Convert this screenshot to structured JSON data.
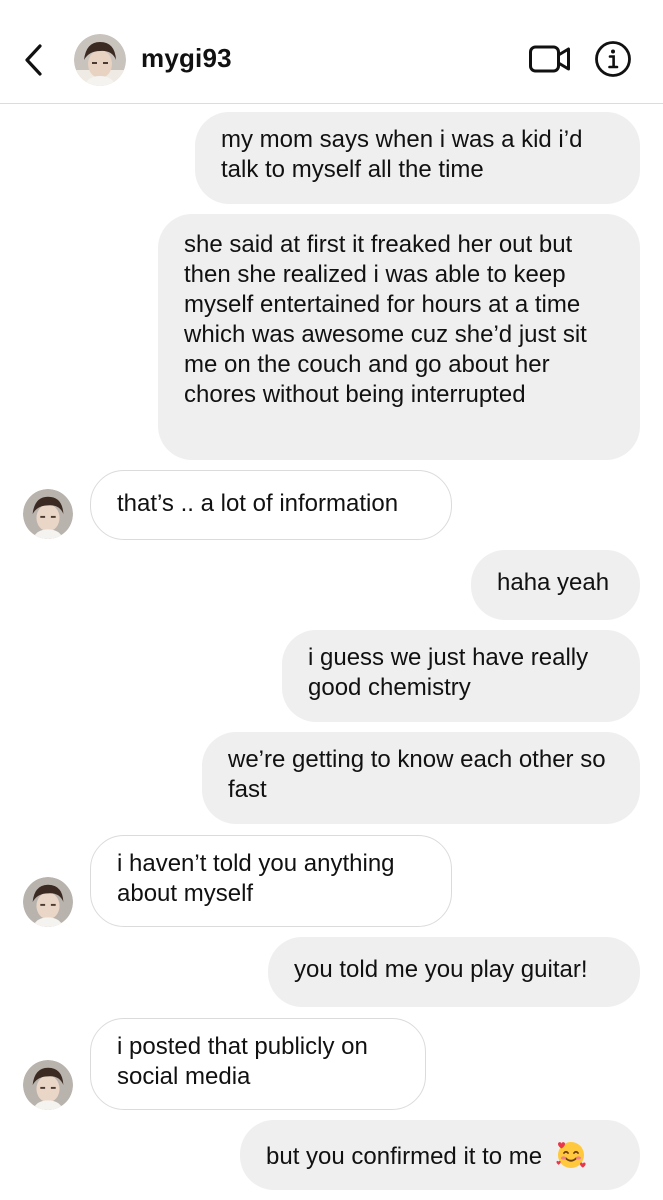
{
  "header": {
    "username": "mygi93",
    "back_icon": "chevron-left-icon",
    "video_icon": "video-camera-icon",
    "info_icon": "info-icon"
  },
  "messages": [
    {
      "from": "me",
      "text": "my mom says when i was a kid i’d talk to myself all the time"
    },
    {
      "from": "me",
      "text": "she said at first it freaked her out but then she realized i was able to keep myself entertained for hours at a time which was awesome cuz she’d just sit me on the couch and go about her chores without being interrupted"
    },
    {
      "from": "them",
      "text": "that’s .. a lot of information"
    },
    {
      "from": "me",
      "text": "haha yeah"
    },
    {
      "from": "me",
      "text": "i guess we just have really good chemistry"
    },
    {
      "from": "me",
      "text": "we’re getting to know each other so fast"
    },
    {
      "from": "them",
      "text": "i haven’t told you anything about myself"
    },
    {
      "from": "me",
      "text": "you told me you play guitar!"
    },
    {
      "from": "them",
      "text": "i posted that publicly on social media"
    },
    {
      "from": "me",
      "text": "but you confirmed it to me",
      "emoji": "smiling-face-with-hearts-icon"
    }
  ],
  "colors": {
    "outgoing_bubble": "#efefef",
    "incoming_border": "#dbdbdb",
    "divider": "#dcdcdc"
  }
}
